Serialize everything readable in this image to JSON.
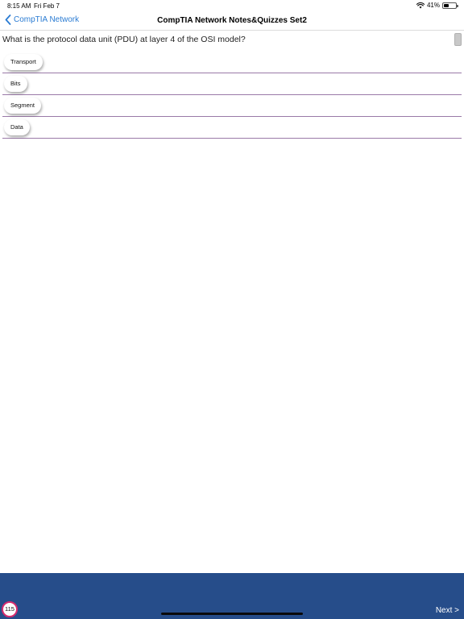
{
  "status": {
    "time": "8:15 AM",
    "date": "Fri Feb 7",
    "battery_text": "41%",
    "battery_level": 0.41
  },
  "nav": {
    "back_label": "CompTIA Network",
    "title": "CompTIA Network Notes&Quizzes Set2"
  },
  "question": {
    "text": "What is the protocol data unit (PDU) at layer 4 of the OSI model?"
  },
  "answers": [
    {
      "label": "Transport"
    },
    {
      "label": "Bits"
    },
    {
      "label": "Segment"
    },
    {
      "label": "Data"
    }
  ],
  "footer": {
    "counter": "115",
    "next_label": "Next >"
  },
  "colors": {
    "accent": "#2b7cd3",
    "footer_bg": "#264d8a",
    "badge_ring": "#d62b6e",
    "divider": "#9a7aa8"
  }
}
